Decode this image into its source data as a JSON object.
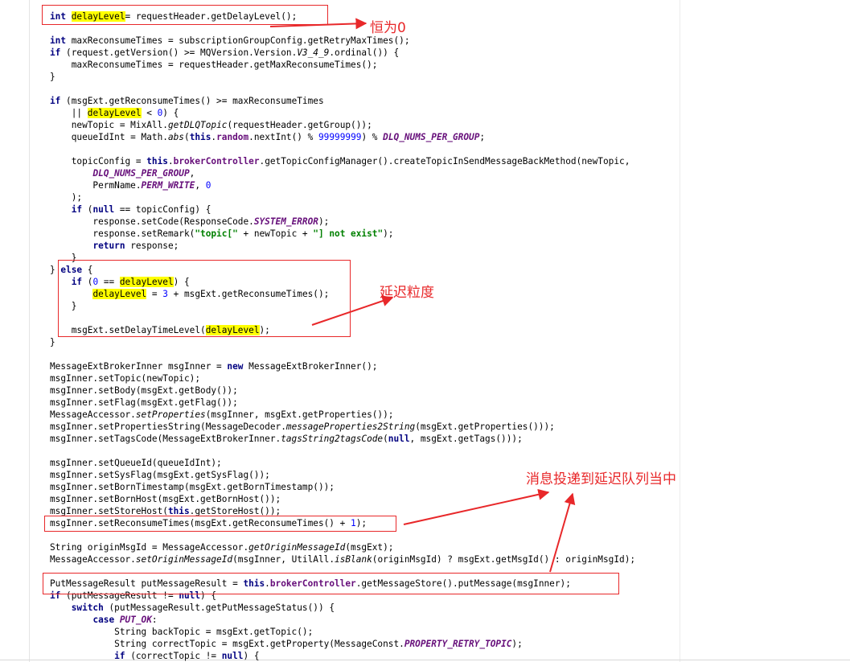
{
  "annotations": {
    "always_zero": "恒为0",
    "delay_granularity": "延迟粒度",
    "deliver_to_delay_queue": "消息投递到延迟队列当中"
  },
  "colors": {
    "annotation_red": "#e8282a",
    "highlight": "#ffff00",
    "keyword": "#000080",
    "number": "#0000ff",
    "string": "#008000",
    "constant": "#660e7a"
  },
  "code": [
    [
      [
        "kw",
        "int "
      ],
      [
        "hl",
        "delayLevel"
      ],
      [
        "",
        "= requestHeader.getDelayLevel();"
      ]
    ],
    [],
    [
      [
        "kw",
        "int "
      ],
      [
        "",
        "maxReconsumeTimes = subscriptionGroupConfig.getRetryMaxTimes();"
      ]
    ],
    [
      [
        "kw",
        "if "
      ],
      [
        "",
        "(request.getVersion() >= MQVersion.Version."
      ],
      [
        "it",
        "V3_4_9"
      ],
      [
        "",
        ".ordinal()) {"
      ]
    ],
    [
      [
        "",
        "    maxReconsumeTimes = requestHeader.getMaxReconsumeTimes();"
      ]
    ],
    [
      [
        "",
        "}"
      ]
    ],
    [],
    [
      [
        "kw",
        "if "
      ],
      [
        "",
        "(msgExt.getReconsumeTimes() >= maxReconsumeTimes"
      ]
    ],
    [
      [
        "",
        "    || "
      ],
      [
        "hl",
        "delayLevel"
      ],
      [
        "",
        " < "
      ],
      [
        "num",
        "0"
      ],
      [
        "",
        ") {"
      ]
    ],
    [
      [
        "",
        "    newTopic = MixAll."
      ],
      [
        "it",
        "getDLQTopic"
      ],
      [
        "",
        "(requestHeader.getGroup());"
      ]
    ],
    [
      [
        "",
        "    queueIdInt = Math."
      ],
      [
        "it",
        "abs"
      ],
      [
        "",
        "("
      ],
      [
        "kw",
        "this"
      ],
      [
        "",
        "."
      ],
      [
        "fld",
        "random"
      ],
      [
        "",
        ".nextInt() % "
      ],
      [
        "num",
        "99999999"
      ],
      [
        "",
        ") % "
      ],
      [
        "cst",
        "DLQ_NUMS_PER_GROUP"
      ],
      [
        "",
        ";"
      ]
    ],
    [],
    [
      [
        "",
        "    topicConfig = "
      ],
      [
        "kw",
        "this"
      ],
      [
        "",
        "."
      ],
      [
        "fld",
        "brokerController"
      ],
      [
        "",
        ".getTopicConfigManager().createTopicInSendMessageBackMethod(newTopic,"
      ]
    ],
    [
      [
        "",
        "        "
      ],
      [
        "cst",
        "DLQ_NUMS_PER_GROUP"
      ],
      [
        "",
        ","
      ]
    ],
    [
      [
        "",
        "        PermName."
      ],
      [
        "cst",
        "PERM_WRITE"
      ],
      [
        "",
        ", "
      ],
      [
        "num",
        "0"
      ]
    ],
    [
      [
        "",
        "    );"
      ]
    ],
    [
      [
        "",
        "    "
      ],
      [
        "kw",
        "if "
      ],
      [
        "",
        "("
      ],
      [
        "kw",
        "null"
      ],
      [
        "",
        " == topicConfig) {"
      ]
    ],
    [
      [
        "",
        "        response.setCode(ResponseCode."
      ],
      [
        "cst",
        "SYSTEM_ERROR"
      ],
      [
        "",
        ");"
      ]
    ],
    [
      [
        "",
        "        response.setRemark("
      ],
      [
        "str",
        "\"topic[\""
      ],
      [
        "",
        " + newTopic + "
      ],
      [
        "str",
        "\"] not exist\""
      ],
      [
        "",
        ");"
      ]
    ],
    [
      [
        "",
        "        "
      ],
      [
        "kw",
        "return "
      ],
      [
        "",
        "response;"
      ]
    ],
    [
      [
        "",
        "    }"
      ]
    ],
    [
      [
        "",
        "} "
      ],
      [
        "kw",
        "else "
      ],
      [
        "",
        "{"
      ]
    ],
    [
      [
        "",
        "    "
      ],
      [
        "kw",
        "if "
      ],
      [
        "",
        "("
      ],
      [
        "num",
        "0"
      ],
      [
        "",
        " == "
      ],
      [
        "hl",
        "delayLevel"
      ],
      [
        "",
        ") {"
      ]
    ],
    [
      [
        "",
        "        "
      ],
      [
        "hl",
        "delayLevel"
      ],
      [
        "",
        " = "
      ],
      [
        "num",
        "3"
      ],
      [
        "",
        " + msgExt.getReconsumeTimes();"
      ]
    ],
    [
      [
        "",
        "    }"
      ]
    ],
    [],
    [
      [
        "",
        "    msgExt.setDelayTimeLevel("
      ],
      [
        "hl",
        "delayLevel"
      ],
      [
        "",
        ");"
      ]
    ],
    [
      [
        "",
        "}"
      ]
    ],
    [],
    [
      [
        "",
        "MessageExtBrokerInner msgInner = "
      ],
      [
        "kw",
        "new "
      ],
      [
        "",
        "MessageExtBrokerInner();"
      ]
    ],
    [
      [
        "",
        "msgInner.setTopic(newTopic);"
      ]
    ],
    [
      [
        "",
        "msgInner.setBody(msgExt.getBody());"
      ]
    ],
    [
      [
        "",
        "msgInner.setFlag(msgExt.getFlag());"
      ]
    ],
    [
      [
        "",
        "MessageAccessor."
      ],
      [
        "it",
        "setProperties"
      ],
      [
        "",
        "(msgInner, msgExt.getProperties());"
      ]
    ],
    [
      [
        "",
        "msgInner.setPropertiesString(MessageDecoder."
      ],
      [
        "it",
        "messageProperties2String"
      ],
      [
        "",
        "(msgExt.getProperties()));"
      ]
    ],
    [
      [
        "",
        "msgInner.setTagsCode(MessageExtBrokerInner."
      ],
      [
        "it",
        "tagsString2tagsCode"
      ],
      [
        "",
        "("
      ],
      [
        "kw",
        "null"
      ],
      [
        "",
        ", msgExt.getTags()));"
      ]
    ],
    [],
    [
      [
        "",
        "msgInner.setQueueId(queueIdInt);"
      ]
    ],
    [
      [
        "",
        "msgInner.setSysFlag(msgExt.getSysFlag());"
      ]
    ],
    [
      [
        "",
        "msgInner.setBornTimestamp(msgExt.getBornTimestamp());"
      ]
    ],
    [
      [
        "",
        "msgInner.setBornHost(msgExt.getBornHost());"
      ]
    ],
    [
      [
        "",
        "msgInner.setStoreHost("
      ],
      [
        "kw",
        "this"
      ],
      [
        "",
        ".getStoreHost());"
      ]
    ],
    [
      [
        "",
        "msgInner.setReconsumeTimes(msgExt.getReconsumeTimes() + "
      ],
      [
        "num",
        "1"
      ],
      [
        "",
        ");"
      ]
    ],
    [],
    [
      [
        "",
        "String originMsgId = MessageAccessor."
      ],
      [
        "it",
        "getOriginMessageId"
      ],
      [
        "",
        "(msgExt);"
      ]
    ],
    [
      [
        "",
        "MessageAccessor."
      ],
      [
        "it",
        "setOriginMessageId"
      ],
      [
        "",
        "(msgInner, UtilAll."
      ],
      [
        "it",
        "isBlank"
      ],
      [
        "",
        "(originMsgId) ? msgExt.getMsgId() : originMsgId);"
      ]
    ],
    [],
    [
      [
        "",
        "PutMessageResult putMessageResult = "
      ],
      [
        "kw",
        "this"
      ],
      [
        "",
        "."
      ],
      [
        "fld",
        "brokerController"
      ],
      [
        "",
        ".getMessageStore().putMessage(msgInner);"
      ]
    ],
    [
      [
        "kw",
        "if "
      ],
      [
        "",
        "(putMessageResult != "
      ],
      [
        "kw",
        "null"
      ],
      [
        "",
        ") {"
      ]
    ],
    [
      [
        "",
        "    "
      ],
      [
        "kw",
        "switch "
      ],
      [
        "",
        "(putMessageResult.getPutMessageStatus()) {"
      ]
    ],
    [
      [
        "",
        "        "
      ],
      [
        "kw",
        "case "
      ],
      [
        "cst",
        "PUT_OK"
      ],
      [
        "",
        ":"
      ]
    ],
    [
      [
        "",
        "            String backTopic = msgExt.getTopic();"
      ]
    ],
    [
      [
        "",
        "            String correctTopic = msgExt.getProperty(MessageConst."
      ],
      [
        "cst",
        "PROPERTY_RETRY_TOPIC"
      ],
      [
        "",
        ");"
      ]
    ],
    [
      [
        "",
        "            "
      ],
      [
        "kw",
        "if "
      ],
      [
        "",
        "(correctTopic != "
      ],
      [
        "kw",
        "null"
      ],
      [
        "",
        ") {"
      ]
    ]
  ]
}
